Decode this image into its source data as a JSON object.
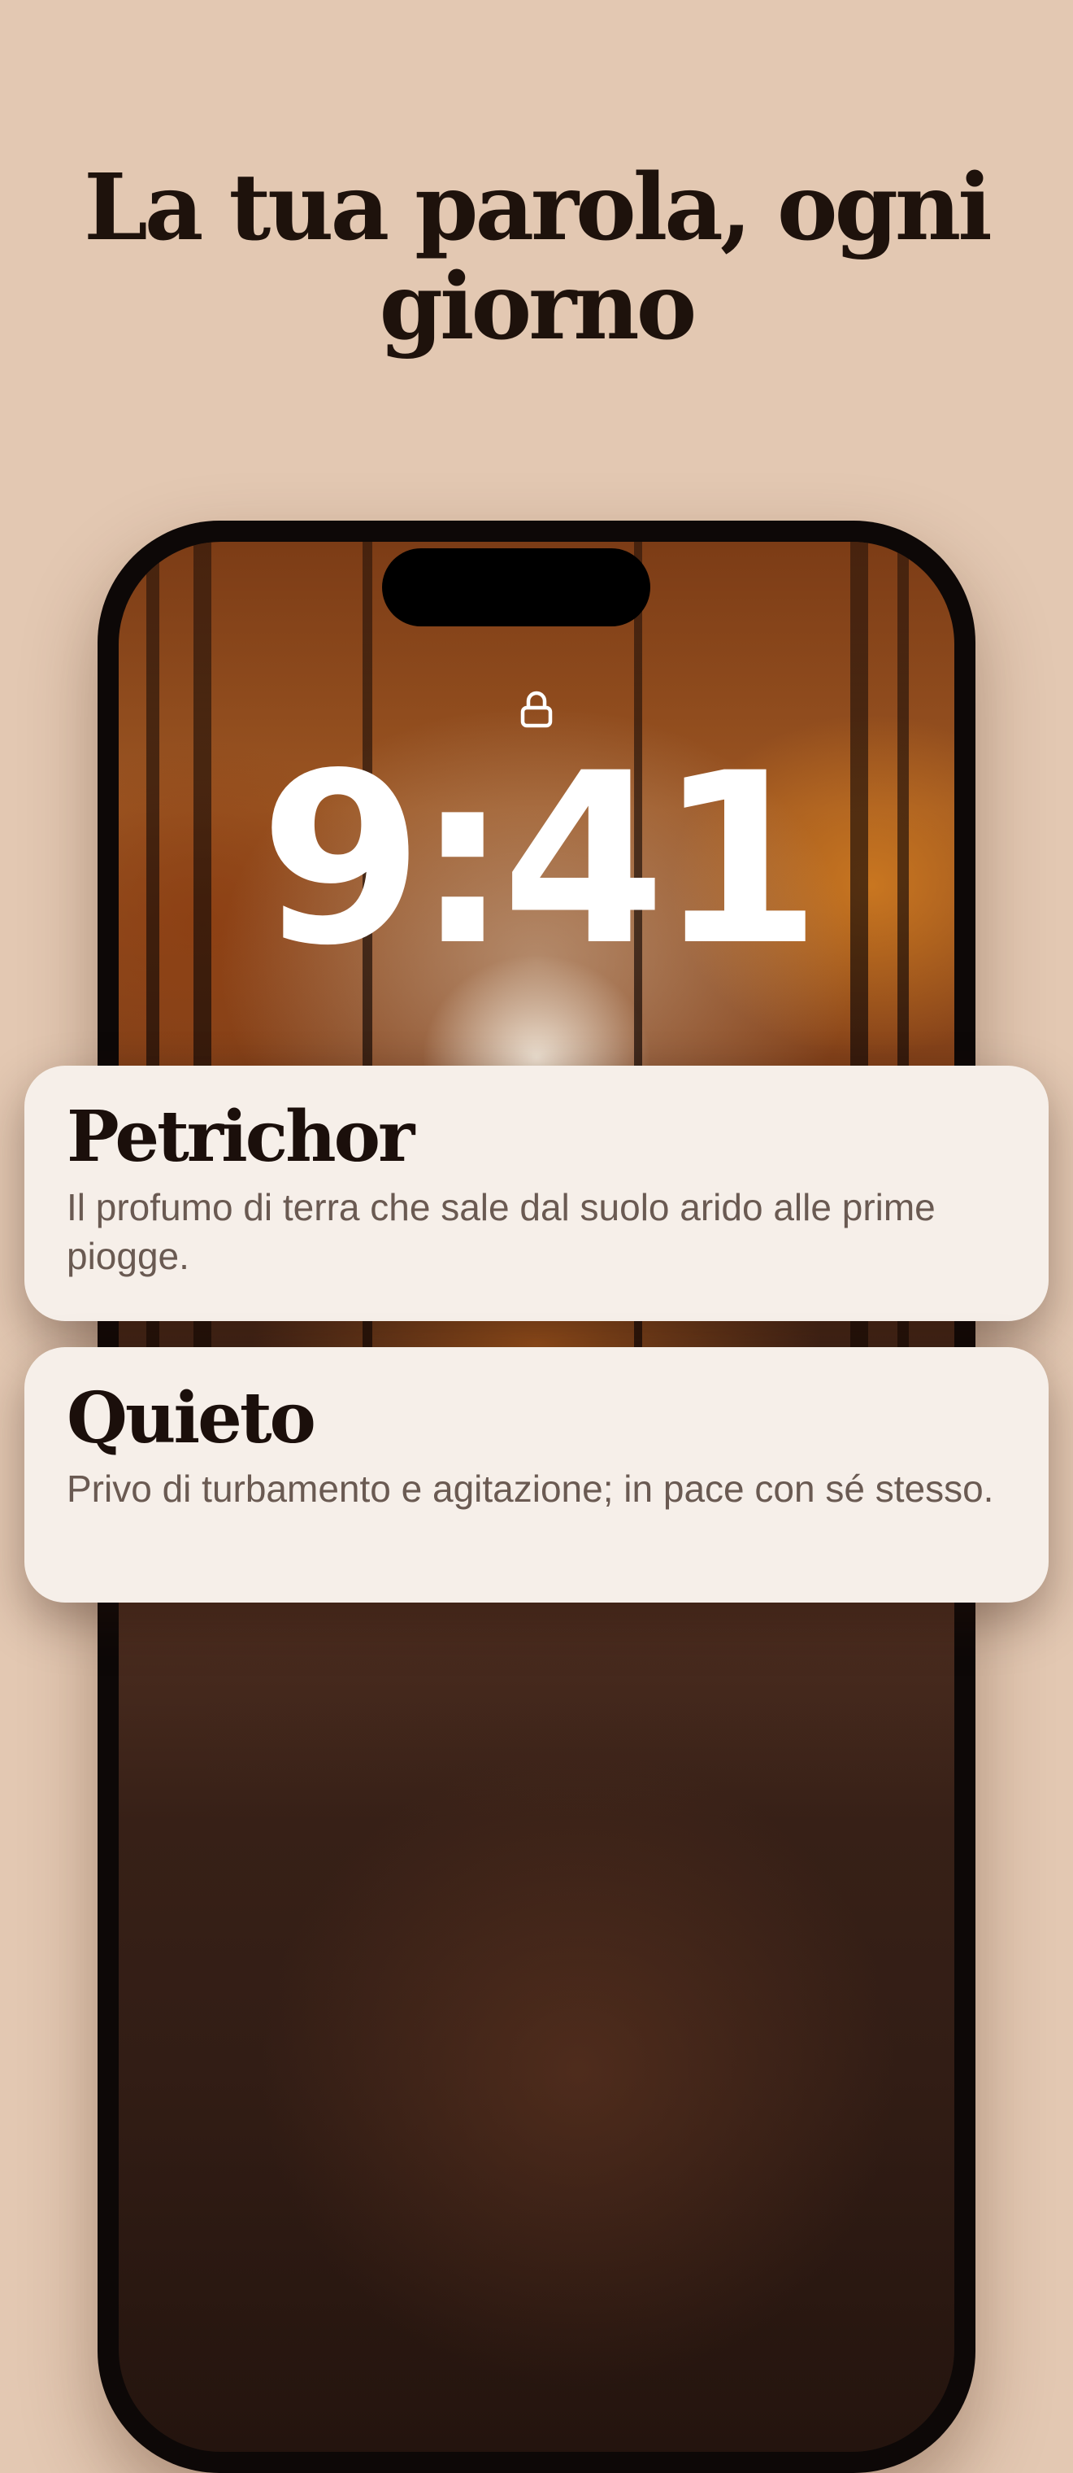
{
  "headline": "La tua parola, ogni giorno",
  "lock_screen": {
    "time": "9:41",
    "lock_icon": "lock-icon"
  },
  "words": [
    {
      "word": "Petrichor",
      "definition": "Il profumo di terra che sale dal suolo arido alle prime piogge."
    },
    {
      "word": "Quieto",
      "definition": "Privo di turbamento e agitazione; in pace con sé stesso."
    }
  ],
  "colors": {
    "background": "#e3c8b2",
    "headline": "#1e120c",
    "card": "#f6efe9",
    "card_word": "#1b0f0b",
    "card_definition": "#6a5a52",
    "phone_frame": "#0d0807"
  }
}
